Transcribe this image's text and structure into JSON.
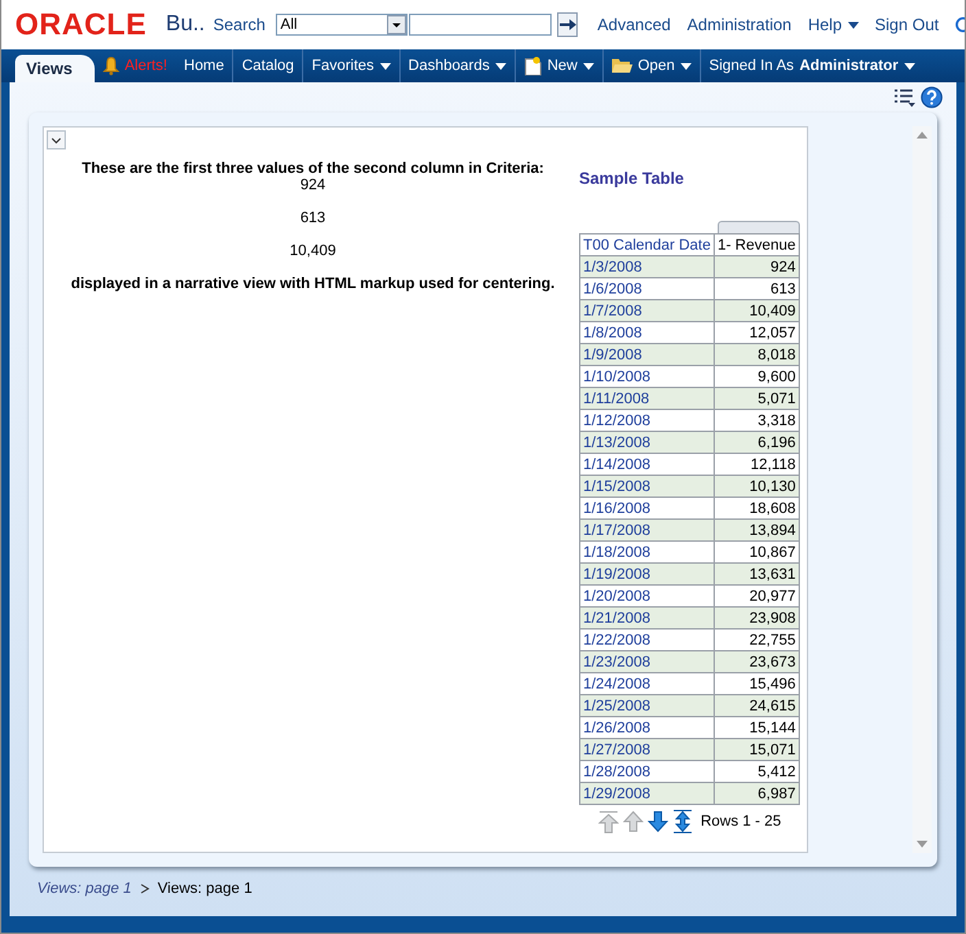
{
  "header": {
    "logo": "ORACLE",
    "app_title": "Bu..",
    "search_label": "Search",
    "scope": {
      "value": "All"
    },
    "links": [
      {
        "label": "Advanced",
        "menu": false
      },
      {
        "label": "Administration",
        "menu": false
      },
      {
        "label": "Help",
        "menu": true
      },
      {
        "label": "Sign Out",
        "menu": false
      }
    ]
  },
  "nav": {
    "tabs": [
      {
        "label": "Views",
        "selected": true
      }
    ],
    "items": [
      {
        "label": "Alerts!",
        "kind": "alert",
        "menu": false
      },
      {
        "label": "Home",
        "kind": "link",
        "menu": false
      },
      {
        "label": "Catalog",
        "kind": "link",
        "menu": false
      },
      {
        "label": "Favorites",
        "kind": "link",
        "menu": true
      },
      {
        "label": "Dashboards",
        "kind": "link",
        "menu": true
      },
      {
        "label": "New",
        "kind": "new",
        "menu": true
      },
      {
        "label": "Open",
        "kind": "open",
        "menu": true
      },
      {
        "label": "Signed In As",
        "kind": "user",
        "menu": true,
        "user": "Administrator"
      }
    ]
  },
  "narrative": {
    "intro": "These are the first three values of the second column in Criteria:",
    "values": [
      "924",
      "613",
      "10,409"
    ],
    "outro": "displayed in a narrative view with HTML markup used for centering."
  },
  "table": {
    "title": "Sample Table",
    "columns": [
      "T00 Calendar Date",
      "1- Revenue"
    ],
    "rows": [
      [
        "1/3/2008",
        "924"
      ],
      [
        "1/6/2008",
        "613"
      ],
      [
        "1/7/2008",
        "10,409"
      ],
      [
        "1/8/2008",
        "12,057"
      ],
      [
        "1/9/2008",
        "8,018"
      ],
      [
        "1/10/2008",
        "9,600"
      ],
      [
        "1/11/2008",
        "5,071"
      ],
      [
        "1/12/2008",
        "3,318"
      ],
      [
        "1/13/2008",
        "6,196"
      ],
      [
        "1/14/2008",
        "12,118"
      ],
      [
        "1/15/2008",
        "10,130"
      ],
      [
        "1/16/2008",
        "18,608"
      ],
      [
        "1/17/2008",
        "13,894"
      ],
      [
        "1/18/2008",
        "10,867"
      ],
      [
        "1/19/2008",
        "13,631"
      ],
      [
        "1/20/2008",
        "20,977"
      ],
      [
        "1/21/2008",
        "23,908"
      ],
      [
        "1/22/2008",
        "22,755"
      ],
      [
        "1/23/2008",
        "23,673"
      ],
      [
        "1/24/2008",
        "15,496"
      ],
      [
        "1/25/2008",
        "24,615"
      ],
      [
        "1/26/2008",
        "15,144"
      ],
      [
        "1/27/2008",
        "15,071"
      ],
      [
        "1/28/2008",
        "5,412"
      ],
      [
        "1/29/2008",
        "6,987"
      ]
    ],
    "pager": {
      "buttons": [
        {
          "kind": "first",
          "disabled": true
        },
        {
          "kind": "prev",
          "disabled": true
        },
        {
          "kind": "next",
          "disabled": false
        },
        {
          "kind": "all",
          "disabled": false
        }
      ],
      "status": "Rows 1 - 25"
    }
  },
  "breadcrumb": [
    {
      "label": "Views: page 1",
      "current": false
    },
    {
      "label": "Views: page 1",
      "current": true
    }
  ]
}
